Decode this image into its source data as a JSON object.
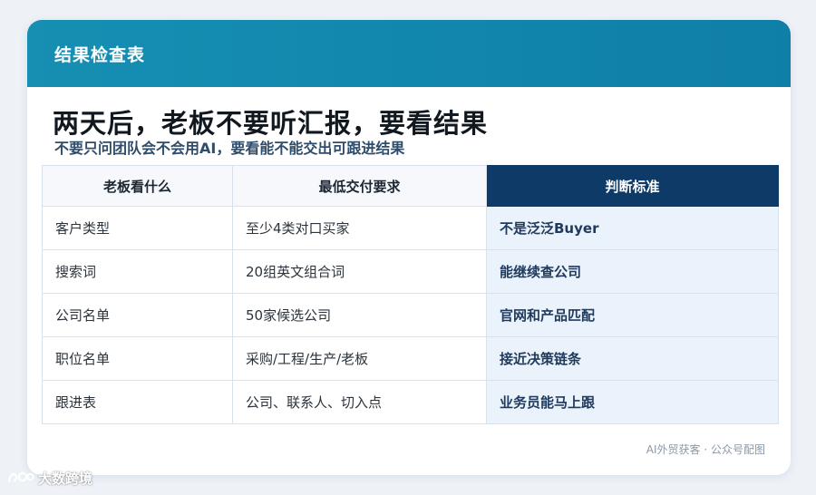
{
  "card": {
    "header_title": "结果检查表",
    "headline": "两天后，老板不要听汇报，要看结果",
    "subline": "不要只问团队会不会用AI，要看能不能交出可跟进结果"
  },
  "table": {
    "headers": [
      "老板看什么",
      "最低交付要求",
      "判断标准"
    ],
    "rows": [
      [
        "客户类型",
        "至少4类对口买家",
        "不是泛泛Buyer"
      ],
      [
        "搜索词",
        "20组英文组合词",
        "能继续查公司"
      ],
      [
        "公司名单",
        "50家候选公司",
        "官网和产品匹配"
      ],
      [
        "职位名单",
        "采购/工程/生产/老板",
        "接近决策链条"
      ],
      [
        "跟进表",
        "公司、联系人、切入点",
        "业务员能马上跟"
      ]
    ]
  },
  "footer": {
    "source": "AI外贸获客 · 公众号配图"
  },
  "watermark": {
    "text": "大数跨境",
    "icon": "logo-mark-icon"
  },
  "colors": {
    "header": "#168fb3",
    "accent_column": "#0e3a68",
    "highlight_cell": "#eaf2fb"
  }
}
